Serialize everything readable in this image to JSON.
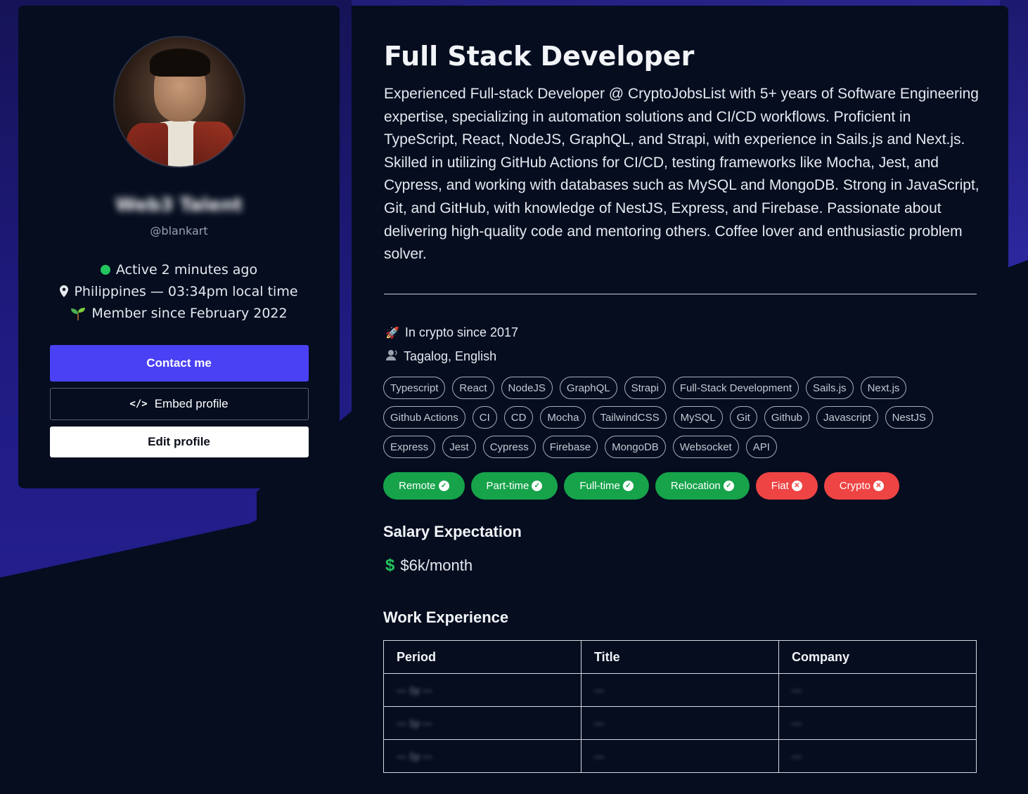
{
  "profile": {
    "display_name": "Web3 Talent",
    "handle": "@blankart",
    "status": "Active 2 minutes ago",
    "location": "Philippines — 03:34pm local time",
    "member_since": "Member since February 2022",
    "contact_label": "Contact me",
    "embed_label": "Embed profile",
    "edit_label": "Edit profile"
  },
  "main": {
    "title": "Full Stack Developer",
    "bio": "Experienced Full-stack Developer @ CryptoJobsList with 5+ years of Software Engineering expertise, specializing in automation solutions and CI/CD workflows. Proficient in TypeScript, React, NodeJS, GraphQL, and Strapi, with experience in Sails.js and Next.js. Skilled in utilizing GitHub Actions for CI/CD, testing frameworks like Mocha, Jest, and Cypress, and working with databases such as MySQL and MongoDB. Strong in JavaScript, Git, and GitHub, with knowledge of NestJS, Express, and Firebase. Passionate about delivering high-quality code and mentoring others. Coffee lover and enthusiastic problem solver.",
    "crypto_since": "In crypto since 2017",
    "languages": "Tagalog, English",
    "skills": [
      "Typescript",
      "React",
      "NodeJS",
      "GraphQL",
      "Strapi",
      "Full-Stack Development",
      "Sails.js",
      "Next.js",
      "Github Actions",
      "CI",
      "CD",
      "Mocha",
      "TailwindCSS",
      "MySQL",
      "Git",
      "Github",
      "Javascript",
      "NestJS",
      "Express",
      "Jest",
      "Cypress",
      "Firebase",
      "MongoDB",
      "Websocket",
      "API"
    ],
    "preferences": [
      {
        "label": "Remote",
        "ok": true
      },
      {
        "label": "Part-time",
        "ok": true
      },
      {
        "label": "Full-time",
        "ok": true
      },
      {
        "label": "Relocation",
        "ok": true
      },
      {
        "label": "Fiat",
        "ok": false
      },
      {
        "label": "Crypto",
        "ok": false
      }
    ],
    "salary_title": "Salary Expectation",
    "salary_value": "$6k/month",
    "work_title": "Work Experience",
    "work_headers": [
      "Period",
      "Title",
      "Company"
    ],
    "work_rows": [
      [
        "— 1y —",
        "—",
        "—"
      ],
      [
        "— 1y —",
        "—",
        "—"
      ],
      [
        "— 1y —",
        "—",
        "—"
      ]
    ]
  },
  "colors": {
    "accent": "#4a41f5",
    "success": "#16a34a",
    "danger": "#ef4444",
    "background": "#050d1f"
  },
  "icons": [
    "pin-icon",
    "sprout-icon",
    "code-icon",
    "rocket-icon",
    "speaker-icon",
    "check-circle-icon",
    "x-circle-icon",
    "dollar-icon"
  ]
}
